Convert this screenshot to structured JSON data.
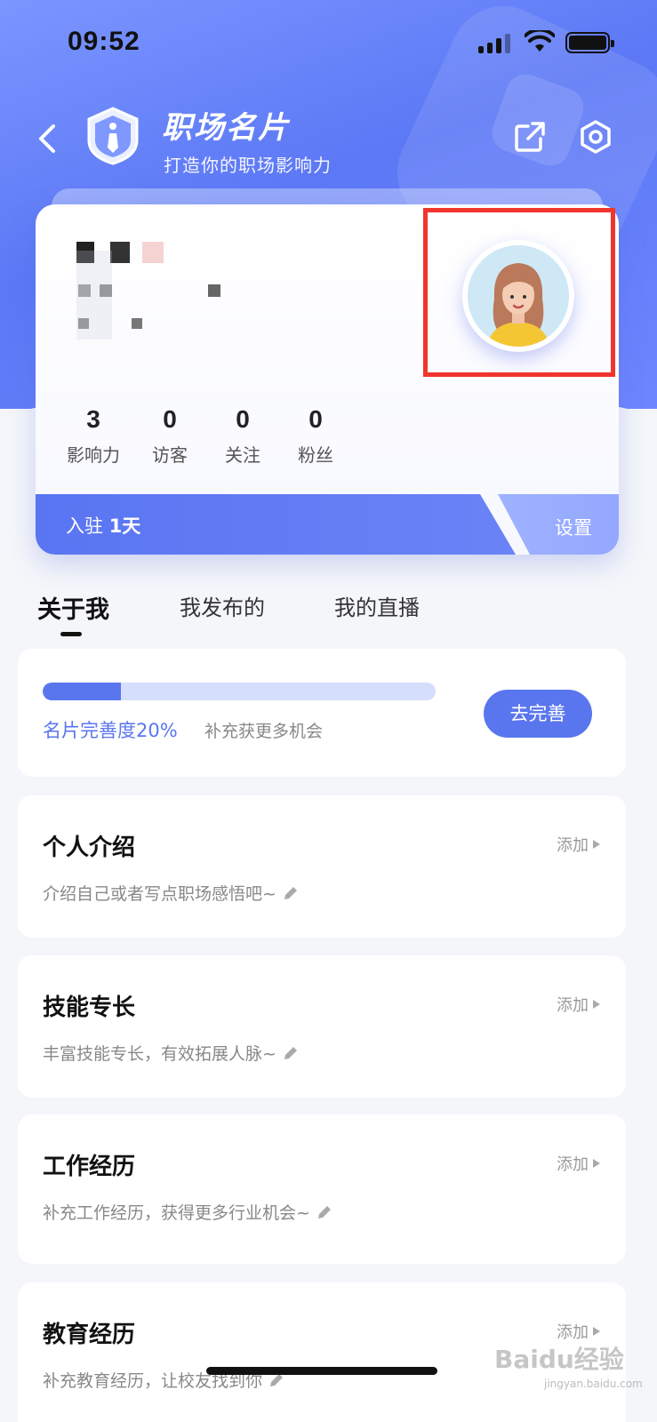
{
  "status_bar": {
    "time": "09:52"
  },
  "header": {
    "title": "职场名片",
    "subtitle": "打造你的职场影响力"
  },
  "card": {
    "stats": [
      {
        "value": "3",
        "label": "影响力"
      },
      {
        "value": "0",
        "label": "访客"
      },
      {
        "value": "0",
        "label": "关注"
      },
      {
        "value": "0",
        "label": "粉丝"
      }
    ],
    "join_prefix": "入驻 ",
    "join_days": "1天",
    "settings_label": "设置"
  },
  "tabs": [
    {
      "label": "关于我",
      "active": true
    },
    {
      "label": "我发布的",
      "active": false
    },
    {
      "label": "我的直播",
      "active": false
    }
  ],
  "completion": {
    "percent": 20,
    "label": "名片完善度20%",
    "hint": "补充获更多机会",
    "button": "去完善"
  },
  "sections": [
    {
      "title": "个人介绍",
      "desc": "介绍自己或者写点职场感悟吧~",
      "action": "添加"
    },
    {
      "title": "技能专长",
      "desc": "丰富技能专长，有效拓展人脉~",
      "action": "添加"
    },
    {
      "title": "工作经历",
      "desc": "补充工作经历，获得更多行业机会~",
      "action": "添加"
    },
    {
      "title": "教育经历",
      "desc": "补充教育经历，让校友找到你",
      "action": "添加"
    }
  ],
  "watermark": {
    "text": "Baidu经验",
    "sub": "jingyan.baidu.com"
  },
  "colors": {
    "accent": "#5a76ef",
    "highlight": "#f0352c"
  }
}
